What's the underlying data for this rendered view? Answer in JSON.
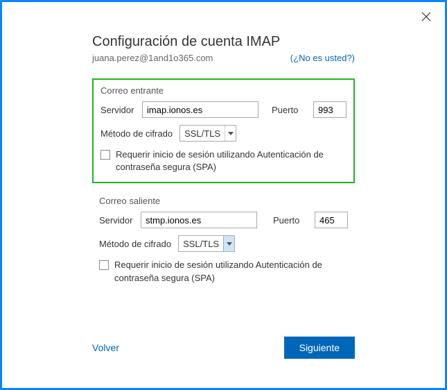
{
  "title": "Configuración de cuenta IMAP",
  "email": "juana.perez@1and1o365.com",
  "not_you": "(¿No es usted?)",
  "incoming": {
    "heading": "Correo entrante",
    "server_label": "Servidor",
    "server_value": "imap.ionos.es",
    "port_label": "Puerto",
    "port_value": "993",
    "encryption_label": "Método de cifrado",
    "encryption_value": "SSL/TLS",
    "spa_label": "Requerir inicio de sesión utilizando Autenticación de contraseña segura (SPA)"
  },
  "outgoing": {
    "heading": "Correo saliente",
    "server_label": "Servidor",
    "server_value": "stmp.ionos.es",
    "port_label": "Puerto",
    "port_value": "465",
    "encryption_label": "Método de cifrado",
    "encryption_value": "SSL/TLS",
    "spa_label": "Requerir inicio de sesión utilizando Autenticación de contraseña segura (SPA)"
  },
  "footer": {
    "back": "Volver",
    "next": "Siguiente"
  }
}
